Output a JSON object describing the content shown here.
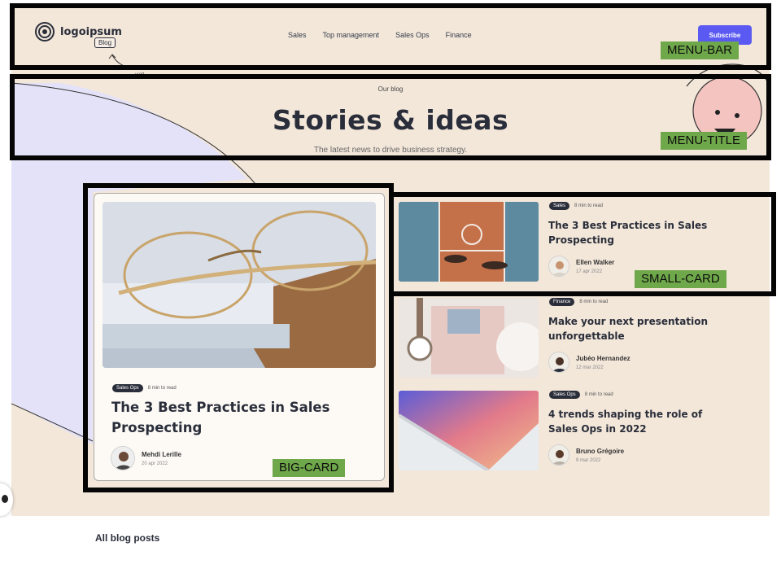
{
  "header": {
    "logo_text": "logoipsum",
    "blog_tag": "Blog",
    "doodle_text": "our blog",
    "nav_items": [
      "Sales",
      "Top management",
      "Sales Ops",
      "Finance"
    ],
    "subscribe_label": "Subscribe"
  },
  "hero": {
    "eyebrow": "Our blog",
    "title": "Stories & ideas",
    "subtitle": "The latest news to drive business strategy."
  },
  "big_card": {
    "tag": "Sales Ops",
    "read_time": "8 min to read",
    "title": "The 3 Best Practices in Sales Prospecting",
    "author": "Mehdi Lerille",
    "date": "20 apr 2022"
  },
  "small_cards": [
    {
      "tag": "Sales",
      "read_time": "8 min to read",
      "title": "The 3 Best Practices in Sales Prospecting",
      "author": "Ellen Walker",
      "date": "17 apr 2022"
    },
    {
      "tag": "Finance",
      "read_time": "8 min to read",
      "title": "Make your next presentation unforgettable",
      "author": "Jubéo Hernandez",
      "date": "12 mar 2022"
    },
    {
      "tag": "Sales Ops",
      "read_time": "8 min to read",
      "title": "4 trends shaping the role of Sales Ops in 2022",
      "author": "Bruno Grégoire",
      "date": "9 mar 2022"
    }
  ],
  "section_title": "All blog posts",
  "annotations": {
    "menu_bar": "MENU-BAR",
    "menu_title": "MENU-TITLE",
    "small_card": "SMALL-CARD",
    "big_card": "BIG-CARD"
  },
  "colors": {
    "accent": "#5a5af2",
    "background": "#f6ece0",
    "lavender": "#e4e2f8",
    "annotation_label": "#6fa84a"
  }
}
